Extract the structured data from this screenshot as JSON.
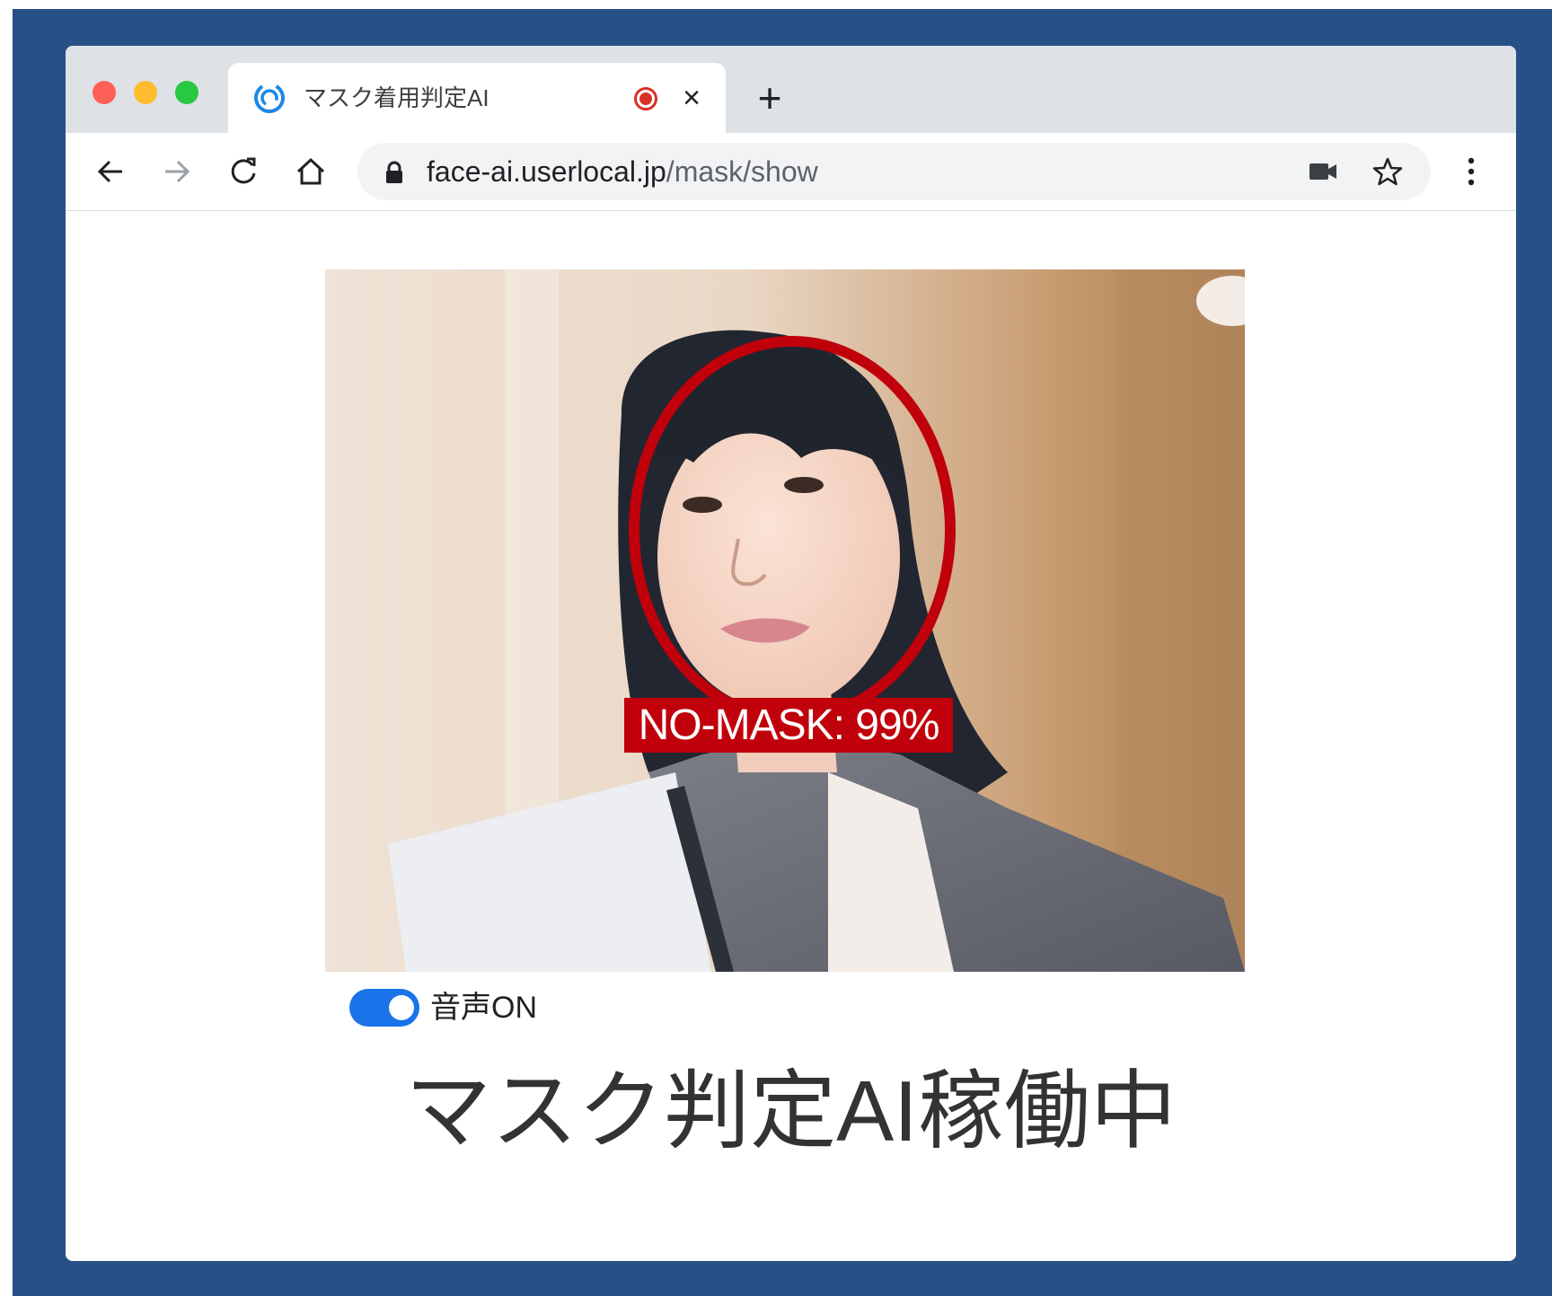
{
  "browser": {
    "tab": {
      "title": "マスク着用判定AI",
      "favicon": "userlocal-logo-icon",
      "recording_indicator": "record-icon",
      "close_icon": "close-icon"
    },
    "new_tab_icon": "plus-icon",
    "toolbar": {
      "back_icon": "back-arrow-icon",
      "forward_icon": "forward-arrow-icon",
      "reload_icon": "reload-icon",
      "home_icon": "home-icon",
      "lock_icon": "lock-icon",
      "url_host": "face-ai.userlocal.jp",
      "url_path": "/mask/show",
      "camera_icon": "video-camera-icon",
      "bookmark_icon": "star-icon",
      "menu_icon": "more-vert-icon"
    }
  },
  "camera": {
    "detection_label": "NO-MASK: 99%",
    "detection_color": "#c0000b"
  },
  "sound_toggle": {
    "label": "音声ON",
    "checked": true,
    "accent": "#1a73e8"
  },
  "status_title": "マスク判定AI稼働中",
  "colors": {
    "frame": "#275087",
    "tabstrip": "#dee1e6"
  }
}
